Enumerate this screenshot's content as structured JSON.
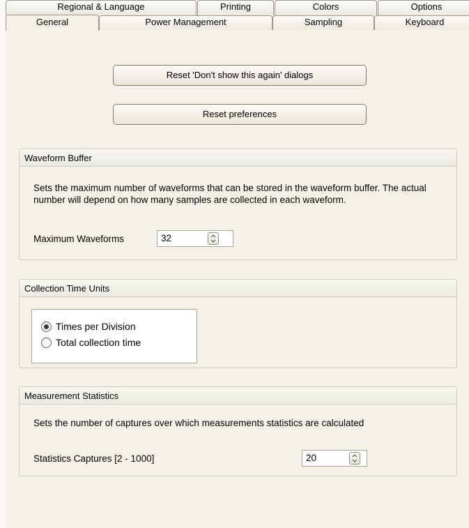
{
  "tabs_back": [
    "Regional & Language",
    "Printing",
    "Colors",
    "Options"
  ],
  "tabs_front": [
    "General",
    "Power Management",
    "Sampling",
    "Keyboard"
  ],
  "buttons": {
    "reset_dialogs": "Reset 'Don't show this again' dialogs",
    "reset_preferences": "Reset preferences"
  },
  "waveform_buffer": {
    "title": "Waveform Buffer",
    "description": "Sets the maximum number of waveforms that can be stored in the waveform buffer. The actual number will depend on how many samples are collected in each waveform.",
    "max_label": "Maximum Waveforms",
    "max_value": "32"
  },
  "collection_time_units": {
    "title": "Collection Time Units",
    "option_1": "Times per Division",
    "option_2": "Total collection time",
    "selected": "Times per Division"
  },
  "measurement_statistics": {
    "title": "Measurement Statistics",
    "description": "Sets the number of captures over which measurements statistics are calculated",
    "captures_label": "Statistics Captures [2 - 1000]",
    "captures_value": "20"
  }
}
